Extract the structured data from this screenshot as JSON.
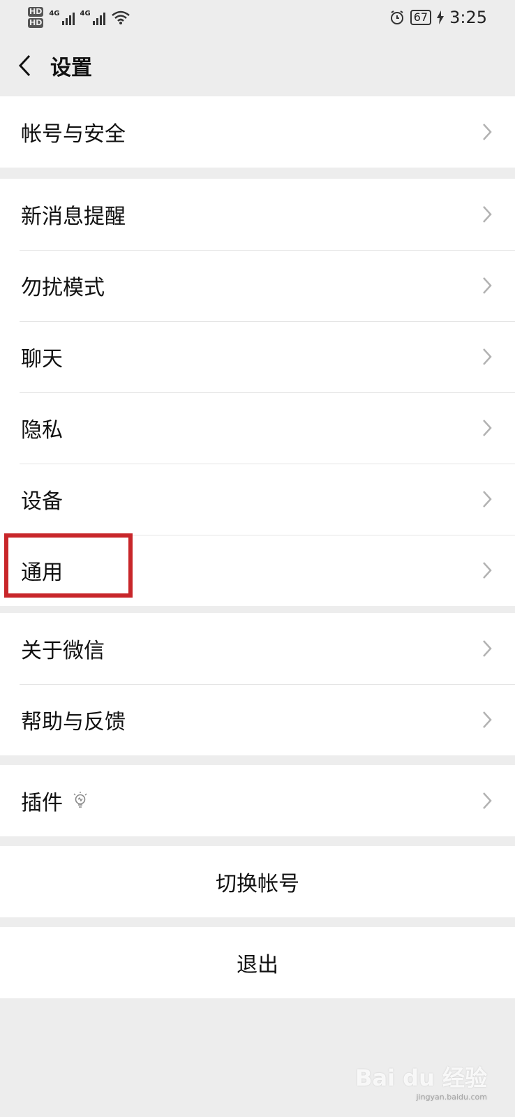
{
  "status_bar": {
    "hd1": "HD",
    "hd2": "HD",
    "net1": "4G",
    "net2": "4G",
    "battery": "67",
    "time": "3:25"
  },
  "navbar": {
    "title": "设置"
  },
  "groups": {
    "account": [
      "帐号与安全"
    ],
    "main": [
      "新消息提醒",
      "勿扰模式",
      "聊天",
      "隐私",
      "设备",
      "通用"
    ],
    "about": [
      "关于微信",
      "帮助与反馈"
    ],
    "plugins": [
      "插件"
    ]
  },
  "actions": {
    "switch_account": "切换帐号",
    "logout": "退出"
  },
  "watermark": {
    "brand": "Bai du 经验",
    "url": "jingyan.baidu.com"
  },
  "highlight_color": "#c8262a"
}
